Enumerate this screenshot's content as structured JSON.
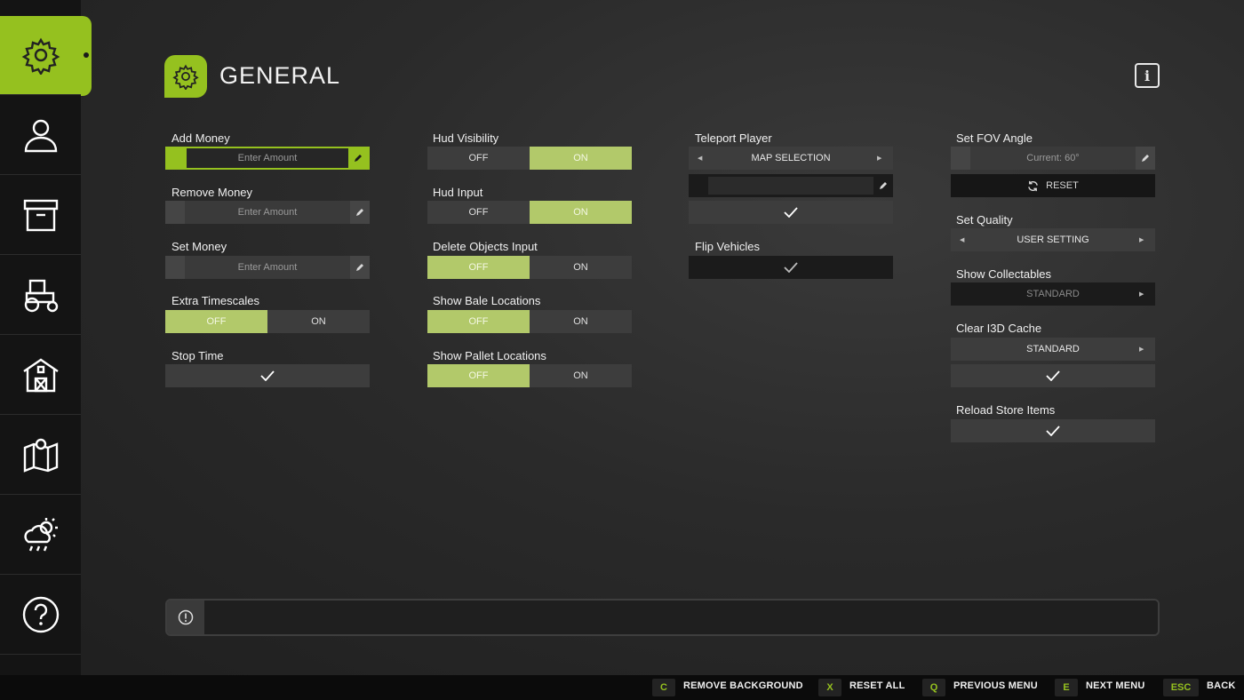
{
  "sidebar": {
    "items": [
      {
        "name": "general",
        "icon": "gear-icon",
        "active": true
      },
      {
        "name": "player",
        "icon": "user-icon",
        "active": false
      },
      {
        "name": "storage",
        "icon": "box-icon",
        "active": false
      },
      {
        "name": "vehicles",
        "icon": "tractor-icon",
        "active": false
      },
      {
        "name": "farm",
        "icon": "barn-icon",
        "active": false
      },
      {
        "name": "map",
        "icon": "map-icon",
        "active": false
      },
      {
        "name": "weather",
        "icon": "weather-icon",
        "active": false
      },
      {
        "name": "help",
        "icon": "help-icon",
        "active": false
      }
    ]
  },
  "header": {
    "title": "GENERAL",
    "icon": "gear-icon"
  },
  "info_button": {
    "label": "i"
  },
  "col1": {
    "add_money": {
      "label": "Add Money",
      "placeholder": "Enter Amount"
    },
    "remove_money": {
      "label": "Remove Money",
      "placeholder": "Enter Amount"
    },
    "set_money": {
      "label": "Set Money",
      "placeholder": "Enter Amount"
    },
    "extra_timescales": {
      "label": "Extra Timescales",
      "off": "OFF",
      "on": "ON",
      "selected": "OFF"
    },
    "stop_time": {
      "label": "Stop Time"
    }
  },
  "col2": {
    "hud_visibility": {
      "label": "Hud Visibility",
      "off": "OFF",
      "on": "ON",
      "selected": "ON"
    },
    "hud_input": {
      "label": "Hud Input",
      "off": "OFF",
      "on": "ON",
      "selected": "ON"
    },
    "delete_objects_input": {
      "label": "Delete Objects Input",
      "off": "OFF",
      "on": "ON",
      "selected": "OFF"
    },
    "show_bale_locations": {
      "label": "Show Bale Locations",
      "off": "OFF",
      "on": "ON",
      "selected": "OFF"
    },
    "show_pallet_locations": {
      "label": "Show Pallet Locations",
      "off": "OFF",
      "on": "ON",
      "selected": "OFF"
    }
  },
  "col3": {
    "teleport_player": {
      "label": "Teleport Player",
      "selection": "MAP SELECTION"
    },
    "flip_vehicles": {
      "label": "Flip Vehicles"
    }
  },
  "col4": {
    "set_fov_angle": {
      "label": "Set FOV Angle",
      "placeholder": "Current: 60°",
      "reset": "RESET"
    },
    "set_quality": {
      "label": "Set Quality",
      "value": "USER SETTING"
    },
    "show_collectables": {
      "label": "Show Collectables",
      "value": "STANDARD"
    },
    "clear_i3d_cache": {
      "label": "Clear I3D Cache",
      "value": "STANDARD"
    },
    "reload_store_items": {
      "label": "Reload Store Items"
    }
  },
  "footer": {
    "shortcuts": [
      {
        "key": "C",
        "label": "REMOVE BACKGROUND"
      },
      {
        "key": "X",
        "label": "RESET ALL"
      },
      {
        "key": "Q",
        "label": "PREVIOUS MENU"
      },
      {
        "key": "E",
        "label": "NEXT MENU"
      },
      {
        "key": "ESC",
        "label": "BACK"
      }
    ]
  },
  "colors": {
    "accent": "#95c11f",
    "toggle_selected": "#b2c96a",
    "panel": "#3d3d3d"
  }
}
